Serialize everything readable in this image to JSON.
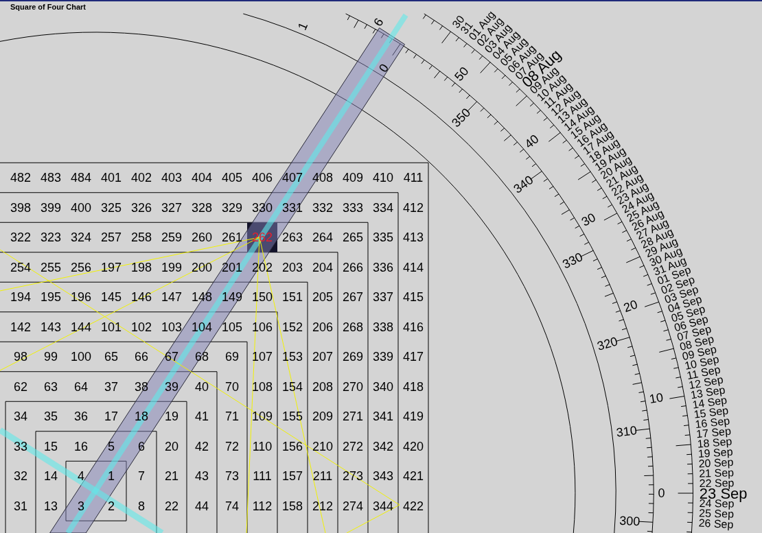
{
  "window": {
    "title": "Square of Four Chart"
  },
  "grid": {
    "rows": [
      {
        "cells": [
          {
            "text": "482",
            "selected": false
          },
          {
            "text": "483",
            "selected": false
          },
          {
            "text": "484",
            "selected": false
          },
          {
            "text": "401",
            "selected": false
          },
          {
            "text": "402",
            "selected": false
          },
          {
            "text": "403",
            "selected": false
          },
          {
            "text": "404",
            "selected": false
          },
          {
            "text": "405",
            "selected": false
          },
          {
            "text": "406",
            "selected": false
          },
          {
            "text": "407",
            "selected": false
          },
          {
            "text": "408",
            "selected": false
          },
          {
            "text": "409",
            "selected": false
          },
          {
            "text": "410",
            "selected": false
          },
          {
            "text": "411",
            "selected": false
          }
        ]
      },
      {
        "cells": [
          {
            "text": "398",
            "selected": false
          },
          {
            "text": "399",
            "selected": false
          },
          {
            "text": "400",
            "selected": false
          },
          {
            "text": "325",
            "selected": false
          },
          {
            "text": "326",
            "selected": false
          },
          {
            "text": "327",
            "selected": false
          },
          {
            "text": "328",
            "selected": false
          },
          {
            "text": "329",
            "selected": false
          },
          {
            "text": "330",
            "selected": false
          },
          {
            "text": "331",
            "selected": false
          },
          {
            "text": "332",
            "selected": false
          },
          {
            "text": "333",
            "selected": false
          },
          {
            "text": "334",
            "selected": false
          },
          {
            "text": "412",
            "selected": false
          }
        ]
      },
      {
        "cells": [
          {
            "text": "322",
            "selected": false
          },
          {
            "text": "323",
            "selected": false
          },
          {
            "text": "324",
            "selected": false
          },
          {
            "text": "257",
            "selected": false
          },
          {
            "text": "258",
            "selected": false
          },
          {
            "text": "259",
            "selected": false
          },
          {
            "text": "260",
            "selected": false
          },
          {
            "text": "261",
            "selected": false
          },
          {
            "text": "262",
            "selected": true
          },
          {
            "text": "263",
            "selected": false
          },
          {
            "text": "264",
            "selected": false
          },
          {
            "text": "265",
            "selected": false
          },
          {
            "text": "335",
            "selected": false
          },
          {
            "text": "413",
            "selected": false
          }
        ]
      },
      {
        "cells": [
          {
            "text": "254",
            "selected": false
          },
          {
            "text": "255",
            "selected": false
          },
          {
            "text": "256",
            "selected": false
          },
          {
            "text": "197",
            "selected": false
          },
          {
            "text": "198",
            "selected": false
          },
          {
            "text": "199",
            "selected": false
          },
          {
            "text": "200",
            "selected": false
          },
          {
            "text": "201",
            "selected": false
          },
          {
            "text": "202",
            "selected": false
          },
          {
            "text": "203",
            "selected": false
          },
          {
            "text": "204",
            "selected": false
          },
          {
            "text": "266",
            "selected": false
          },
          {
            "text": "336",
            "selected": false
          },
          {
            "text": "414",
            "selected": false
          }
        ]
      },
      {
        "cells": [
          {
            "text": "194",
            "selected": false
          },
          {
            "text": "195",
            "selected": false
          },
          {
            "text": "196",
            "selected": false
          },
          {
            "text": "145",
            "selected": false
          },
          {
            "text": "146",
            "selected": false
          },
          {
            "text": "147",
            "selected": false
          },
          {
            "text": "148",
            "selected": false
          },
          {
            "text": "149",
            "selected": false
          },
          {
            "text": "150",
            "selected": false
          },
          {
            "text": "151",
            "selected": false
          },
          {
            "text": "205",
            "selected": false
          },
          {
            "text": "267",
            "selected": false
          },
          {
            "text": "337",
            "selected": false
          },
          {
            "text": "415",
            "selected": false
          }
        ]
      },
      {
        "cells": [
          {
            "text": "142",
            "selected": false
          },
          {
            "text": "143",
            "selected": false
          },
          {
            "text": "144",
            "selected": false
          },
          {
            "text": "101",
            "selected": false
          },
          {
            "text": "102",
            "selected": false
          },
          {
            "text": "103",
            "selected": false
          },
          {
            "text": "104",
            "selected": false
          },
          {
            "text": "105",
            "selected": false
          },
          {
            "text": "106",
            "selected": false
          },
          {
            "text": "152",
            "selected": false
          },
          {
            "text": "206",
            "selected": false
          },
          {
            "text": "268",
            "selected": false
          },
          {
            "text": "338",
            "selected": false
          },
          {
            "text": "416",
            "selected": false
          }
        ]
      },
      {
        "cells": [
          {
            "text": "98",
            "selected": false
          },
          {
            "text": "99",
            "selected": false
          },
          {
            "text": "100",
            "selected": false
          },
          {
            "text": "65",
            "selected": false
          },
          {
            "text": "66",
            "selected": false
          },
          {
            "text": "67",
            "selected": false
          },
          {
            "text": "68",
            "selected": false
          },
          {
            "text": "69",
            "selected": false
          },
          {
            "text": "107",
            "selected": false
          },
          {
            "text": "153",
            "selected": false
          },
          {
            "text": "207",
            "selected": false
          },
          {
            "text": "269",
            "selected": false
          },
          {
            "text": "339",
            "selected": false
          },
          {
            "text": "417",
            "selected": false
          }
        ]
      },
      {
        "cells": [
          {
            "text": "62",
            "selected": false
          },
          {
            "text": "63",
            "selected": false
          },
          {
            "text": "64",
            "selected": false
          },
          {
            "text": "37",
            "selected": false
          },
          {
            "text": "38",
            "selected": false
          },
          {
            "text": "39",
            "selected": false
          },
          {
            "text": "40",
            "selected": false
          },
          {
            "text": "70",
            "selected": false
          },
          {
            "text": "108",
            "selected": false
          },
          {
            "text": "154",
            "selected": false
          },
          {
            "text": "208",
            "selected": false
          },
          {
            "text": "270",
            "selected": false
          },
          {
            "text": "340",
            "selected": false
          },
          {
            "text": "418",
            "selected": false
          }
        ]
      },
      {
        "cells": [
          {
            "text": "34",
            "selected": false
          },
          {
            "text": "35",
            "selected": false
          },
          {
            "text": "36",
            "selected": false
          },
          {
            "text": "17",
            "selected": false
          },
          {
            "text": "18",
            "selected": false
          },
          {
            "text": "19",
            "selected": false
          },
          {
            "text": "41",
            "selected": false
          },
          {
            "text": "71",
            "selected": false
          },
          {
            "text": "109",
            "selected": false
          },
          {
            "text": "155",
            "selected": false
          },
          {
            "text": "209",
            "selected": false
          },
          {
            "text": "271",
            "selected": false
          },
          {
            "text": "341",
            "selected": false
          },
          {
            "text": "419",
            "selected": false
          }
        ]
      },
      {
        "cells": [
          {
            "text": "33",
            "selected": false
          },
          {
            "text": "15",
            "selected": false
          },
          {
            "text": "16",
            "selected": false
          },
          {
            "text": "5",
            "selected": false
          },
          {
            "text": "6",
            "selected": false
          },
          {
            "text": "20",
            "selected": false
          },
          {
            "text": "42",
            "selected": false
          },
          {
            "text": "72",
            "selected": false
          },
          {
            "text": "110",
            "selected": false
          },
          {
            "text": "156",
            "selected": false
          },
          {
            "text": "210",
            "selected": false
          },
          {
            "text": "272",
            "selected": false
          },
          {
            "text": "342",
            "selected": false
          },
          {
            "text": "420",
            "selected": false
          }
        ]
      },
      {
        "cells": [
          {
            "text": "32",
            "selected": false
          },
          {
            "text": "14",
            "selected": false
          },
          {
            "text": "4",
            "selected": false
          },
          {
            "text": "1",
            "selected": false
          },
          {
            "text": "7",
            "selected": false
          },
          {
            "text": "21",
            "selected": false
          },
          {
            "text": "43",
            "selected": false
          },
          {
            "text": "73",
            "selected": false
          },
          {
            "text": "111",
            "selected": false
          },
          {
            "text": "157",
            "selected": false
          },
          {
            "text": "211",
            "selected": false
          },
          {
            "text": "273",
            "selected": false
          },
          {
            "text": "343",
            "selected": false
          },
          {
            "text": "421",
            "selected": false
          }
        ]
      },
      {
        "cells": [
          {
            "text": "31",
            "selected": false
          },
          {
            "text": "13",
            "selected": false
          },
          {
            "text": "3",
            "selected": false
          },
          {
            "text": "2",
            "selected": false
          },
          {
            "text": "8",
            "selected": false
          },
          {
            "text": "22",
            "selected": false
          },
          {
            "text": "44",
            "selected": false
          },
          {
            "text": "74",
            "selected": false
          },
          {
            "text": "112",
            "selected": false
          },
          {
            "text": "158",
            "selected": false
          },
          {
            "text": "212",
            "selected": false
          },
          {
            "text": "274",
            "selected": false
          },
          {
            "text": "344",
            "selected": false
          },
          {
            "text": "422",
            "selected": false
          }
        ]
      }
    ]
  },
  "degree_scale": {
    "outer_labels": [
      "0",
      "10",
      "20",
      "30",
      "40",
      "50",
      "6"
    ],
    "inner_labels": [
      "300",
      "310",
      "320",
      "330",
      "340",
      "350",
      "0",
      "1"
    ]
  },
  "date_scale": {
    "labels": [
      {
        "text": "30",
        "major": false
      },
      {
        "text": "31",
        "major": false
      },
      {
        "text": "01 Aug",
        "major": false
      },
      {
        "text": "02 Aug",
        "major": false
      },
      {
        "text": "03 Aug",
        "major": false
      },
      {
        "text": "04 Aug",
        "major": false
      },
      {
        "text": "05 Aug",
        "major": false
      },
      {
        "text": "06 Aug",
        "major": false
      },
      {
        "text": "07 Aug",
        "major": false
      },
      {
        "text": "08 Aug",
        "major": true
      },
      {
        "text": "09 Aug",
        "major": false
      },
      {
        "text": "10 Aug",
        "major": false
      },
      {
        "text": "11 Aug",
        "major": false
      },
      {
        "text": "12 Aug",
        "major": false
      },
      {
        "text": "13 Aug",
        "major": false
      },
      {
        "text": "14 Aug",
        "major": false
      },
      {
        "text": "15 Aug",
        "major": false
      },
      {
        "text": "16 Aug",
        "major": false
      },
      {
        "text": "17 Aug",
        "major": false
      },
      {
        "text": "18 Aug",
        "major": false
      },
      {
        "text": "19 Aug",
        "major": false
      },
      {
        "text": "20 Aug",
        "major": false
      },
      {
        "text": "21 Aug",
        "major": false
      },
      {
        "text": "22 Aug",
        "major": false
      },
      {
        "text": "23 Aug",
        "major": false
      },
      {
        "text": "24 Aug",
        "major": false
      },
      {
        "text": "25 Aug",
        "major": false
      },
      {
        "text": "26 Aug",
        "major": false
      },
      {
        "text": "27 Aug",
        "major": false
      },
      {
        "text": "28 Aug",
        "major": false
      },
      {
        "text": "29 Aug",
        "major": false
      },
      {
        "text": "30 Aug",
        "major": false
      },
      {
        "text": "31 Aug",
        "major": false
      },
      {
        "text": "01 Sep",
        "major": false
      },
      {
        "text": "02 Sep",
        "major": false
      },
      {
        "text": "03 Sep",
        "major": false
      },
      {
        "text": "04 Sep",
        "major": false
      },
      {
        "text": "05 Sep",
        "major": false
      },
      {
        "text": "06 Sep",
        "major": false
      },
      {
        "text": "07 Sep",
        "major": false
      },
      {
        "text": "08 Sep",
        "major": false
      },
      {
        "text": "09 Sep",
        "major": false
      },
      {
        "text": "10 Sep",
        "major": false
      },
      {
        "text": "11 Sep",
        "major": false
      },
      {
        "text": "12 Sep",
        "major": false
      },
      {
        "text": "13 Sep",
        "major": false
      },
      {
        "text": "14 Sep",
        "major": false
      },
      {
        "text": "15 Sep",
        "major": false
      },
      {
        "text": "16 Sep",
        "major": false
      },
      {
        "text": "17 Sep",
        "major": false
      },
      {
        "text": "18 Sep",
        "major": false
      },
      {
        "text": "19 Sep",
        "major": false
      },
      {
        "text": "20 Sep",
        "major": false
      },
      {
        "text": "21 Sep",
        "major": false
      },
      {
        "text": "22 Sep",
        "major": false
      },
      {
        "text": "23 Sep",
        "major": true
      },
      {
        "text": "24 Sep",
        "major": false
      },
      {
        "text": "25 Sep",
        "major": false
      },
      {
        "text": "26 Sep",
        "major": false
      }
    ]
  }
}
